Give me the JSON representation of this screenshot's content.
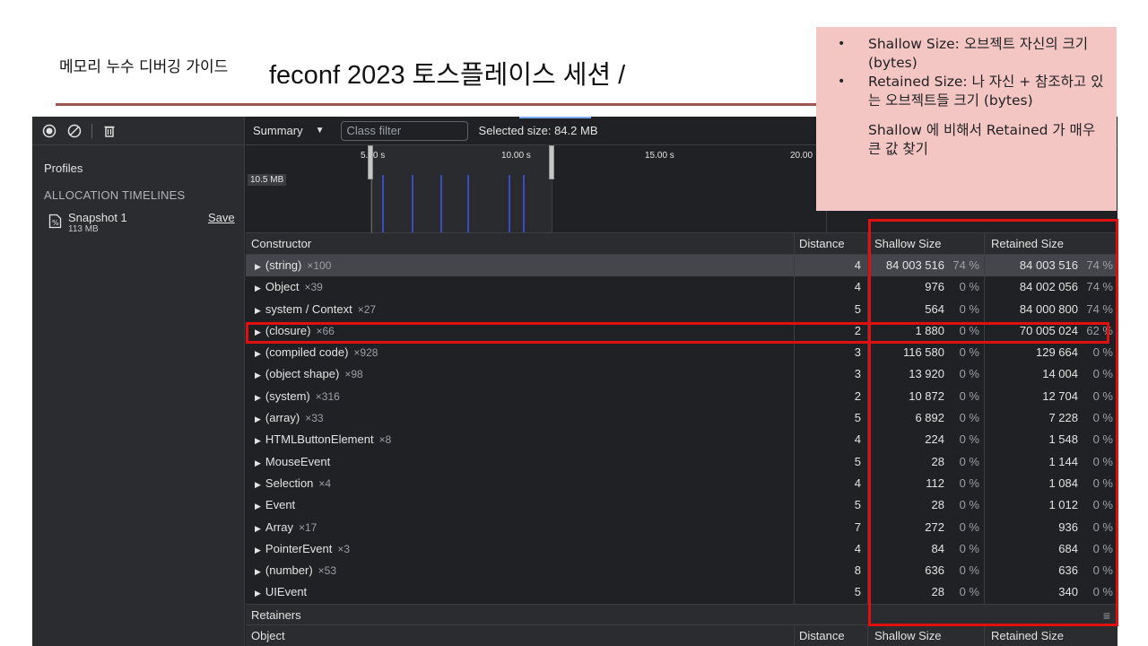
{
  "slide": {
    "title_main": "feconf 2023 토스플레이스 세션 / ",
    "title_sub": "메모리 누수 디버깅 가이드"
  },
  "note": {
    "bullets": [
      "Shallow Size: 오브젝트 자신의 크기 (bytes)",
      "Retained Size: 나 자신 + 참조하고 있는 오브젝트들 크기 (bytes)"
    ],
    "extra": "Shallow 에 비해서 Retained 가 매우 큰 값 찾기"
  },
  "toolbar": {
    "icons": [
      "record-icon",
      "clear-icon",
      "trash-icon"
    ],
    "view": "Summary",
    "class_filter_placeholder": "Class filter",
    "selected_size": "Selected size: 84.2 MB"
  },
  "sidebar": {
    "profiles_label": "Profiles",
    "section_label": "ALLOCATION TIMELINES",
    "snapshot": {
      "name": "Snapshot 1",
      "size": "113 MB",
      "save": "Save"
    }
  },
  "timeline": {
    "ticks": [
      "5.00 s",
      "10.00 s",
      "15.00 s",
      "20.00"
    ],
    "mb_label": "10.5 MB"
  },
  "table": {
    "headers": {
      "constructor": "Constructor",
      "distance": "Distance",
      "shallow": "Shallow Size",
      "retained": "Retained Size"
    },
    "rows": [
      {
        "name": "(string)",
        "count": "×100",
        "distance": "4",
        "shallow": "84 003 516",
        "shallow_pct": "74 %",
        "retained": "84 003 516",
        "retained_pct": "74 %",
        "selected": true
      },
      {
        "name": "Object",
        "count": "×39",
        "distance": "4",
        "shallow": "976",
        "shallow_pct": "0 %",
        "retained": "84 002 056",
        "retained_pct": "74 %"
      },
      {
        "name": "system / Context",
        "count": "×27",
        "distance": "5",
        "shallow": "564",
        "shallow_pct": "0 %",
        "retained": "84 000 800",
        "retained_pct": "74 %"
      },
      {
        "name": "(closure)",
        "count": "×66",
        "distance": "2",
        "shallow": "1 880",
        "shallow_pct": "0 %",
        "retained": "70 005 024",
        "retained_pct": "62 %"
      },
      {
        "name": "(compiled code)",
        "count": "×928",
        "distance": "3",
        "shallow": "116 580",
        "shallow_pct": "0 %",
        "retained": "129 664",
        "retained_pct": "0 %"
      },
      {
        "name": "(object shape)",
        "count": "×98",
        "distance": "3",
        "shallow": "13 920",
        "shallow_pct": "0 %",
        "retained": "14 004",
        "retained_pct": "0 %"
      },
      {
        "name": "(system)",
        "count": "×316",
        "distance": "2",
        "shallow": "10 872",
        "shallow_pct": "0 %",
        "retained": "12 704",
        "retained_pct": "0 %"
      },
      {
        "name": "(array)",
        "count": "×33",
        "distance": "5",
        "shallow": "6 892",
        "shallow_pct": "0 %",
        "retained": "7 228",
        "retained_pct": "0 %"
      },
      {
        "name": "HTMLButtonElement",
        "count": "×8",
        "distance": "4",
        "shallow": "224",
        "shallow_pct": "0 %",
        "retained": "1 548",
        "retained_pct": "0 %"
      },
      {
        "name": "MouseEvent",
        "count": "",
        "distance": "5",
        "shallow": "28",
        "shallow_pct": "0 %",
        "retained": "1 144",
        "retained_pct": "0 %"
      },
      {
        "name": "Selection",
        "count": "×4",
        "distance": "4",
        "shallow": "112",
        "shallow_pct": "0 %",
        "retained": "1 084",
        "retained_pct": "0 %"
      },
      {
        "name": "Event",
        "count": "",
        "distance": "5",
        "shallow": "28",
        "shallow_pct": "0 %",
        "retained": "1 012",
        "retained_pct": "0 %"
      },
      {
        "name": "Array",
        "count": "×17",
        "distance": "7",
        "shallow": "272",
        "shallow_pct": "0 %",
        "retained": "936",
        "retained_pct": "0 %"
      },
      {
        "name": "PointerEvent",
        "count": "×3",
        "distance": "4",
        "shallow": "84",
        "shallow_pct": "0 %",
        "retained": "684",
        "retained_pct": "0 %"
      },
      {
        "name": "(number)",
        "count": "×53",
        "distance": "8",
        "shallow": "636",
        "shallow_pct": "0 %",
        "retained": "636",
        "retained_pct": "0 %"
      },
      {
        "name": "UIEvent",
        "count": "",
        "distance": "5",
        "shallow": "28",
        "shallow_pct": "0 %",
        "retained": "340",
        "retained_pct": "0 %"
      }
    ]
  },
  "retainers": {
    "label": "Retainers",
    "headers": {
      "object": "Object",
      "distance": "Distance",
      "shallow": "Shallow Size",
      "retained": "Retained Size"
    }
  },
  "colors": {
    "highlight": "#e01010",
    "note_bg": "#f3c6c4",
    "title_rule": "#a05650",
    "panel_bg": "#202124"
  }
}
